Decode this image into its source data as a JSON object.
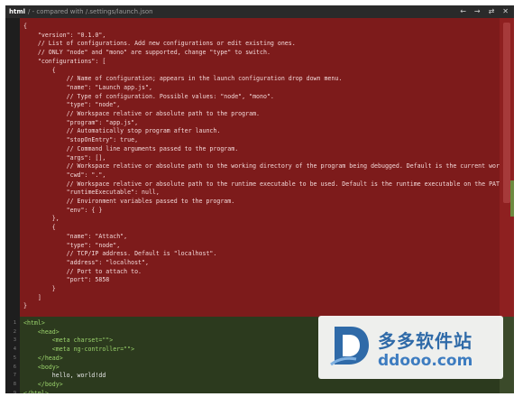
{
  "titlebar": {
    "filename": "html",
    "compare_text": "/ - compared with /.settings/launch.json",
    "nav_prev": "←",
    "nav_next": "→",
    "nav_swap": "⇄",
    "nav_close": "✕"
  },
  "removed_lines": [
    "{",
    "    \"version\": \"0.1.0\",",
    "    // List of configurations. Add new configurations or edit existing ones.",
    "    // ONLY \"node\" and \"mono\" are supported, change \"type\" to switch.",
    "    \"configurations\": [",
    "        {",
    "            // Name of configuration; appears in the launch configuration drop down menu.",
    "            \"name\": \"Launch app.js\",",
    "            // Type of configuration. Possible values: \"node\", \"mono\".",
    "            \"type\": \"node\",",
    "            // Workspace relative or absolute path to the program.",
    "            \"program\": \"app.js\",",
    "            // Automatically stop program after launch.",
    "            \"stopOnEntry\": true,",
    "            // Command line arguments passed to the program.",
    "            \"args\": [],",
    "            // Workspace relative or absolute path to the working directory of the program being debugged. Default is the current workspac",
    "            \"cwd\": \".\",",
    "            // Workspace relative or absolute path to the runtime executable to be used. Default is the runtime executable on the PATH.",
    "            \"runtimeExecutable\": null,",
    "            // Environment variables passed to the program.",
    "            \"env\": { }",
    "        },",
    "        {",
    "            \"name\": \"Attach\",",
    "            \"type\": \"node\",",
    "            // TCP/IP address. Default is \"localhost\".",
    "            \"address\": \"localhost\",",
    "            // Port to attach to.",
    "            \"port\": 5858",
    "        }",
    "    ]",
    "}"
  ],
  "added_lines": [
    {
      "num": "1",
      "text": "<html>"
    },
    {
      "num": "2",
      "text": "    <head>"
    },
    {
      "num": "3",
      "text": "        <meta charset=\"\">"
    },
    {
      "num": "4",
      "text": "        <meta ng-controller=\"\">"
    },
    {
      "num": "5",
      "text": "    </head>"
    },
    {
      "num": "6",
      "text": "    <body>"
    },
    {
      "num": "7",
      "text": "        hello, world!dd"
    },
    {
      "num": "8",
      "text": "    </body>"
    },
    {
      "num": "9",
      "text": "</html>"
    }
  ],
  "watermark": {
    "brand_cn": "多多软件站",
    "url": "ddooo.com"
  },
  "colors": {
    "removed_bg": "#7d1b1b",
    "added_bg": "#2c3a1e",
    "watermark_blue": "#2f6aa8"
  }
}
